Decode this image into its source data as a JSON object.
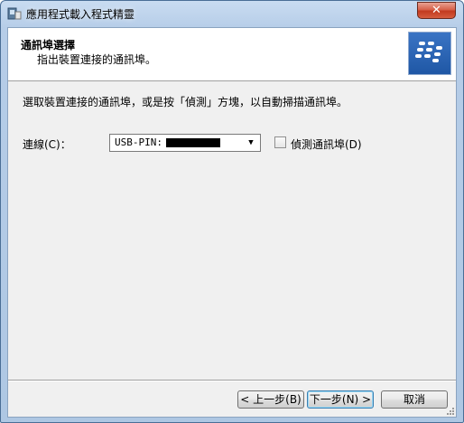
{
  "window": {
    "title": "應用程式載入程式精靈",
    "close_glyph": "✕"
  },
  "header": {
    "title": "通訊埠選擇",
    "subtitle": "指出裝置連接的通訊埠。"
  },
  "main": {
    "instruction": "選取裝置連接的通訊埠，或是按「偵測」方塊，以自動掃描通訊埠。",
    "port_label": "連線(C)：",
    "port_value": "USB-PIN: ",
    "detect_label": "偵測通訊埠(D)",
    "detect_checked": false
  },
  "buttons": {
    "back": "< 上一步(B)",
    "next": "下一步(N) >",
    "cancel": "取消"
  },
  "colors": {
    "logo_bg": "#1f57a5",
    "close_red": "#c23a1f"
  }
}
